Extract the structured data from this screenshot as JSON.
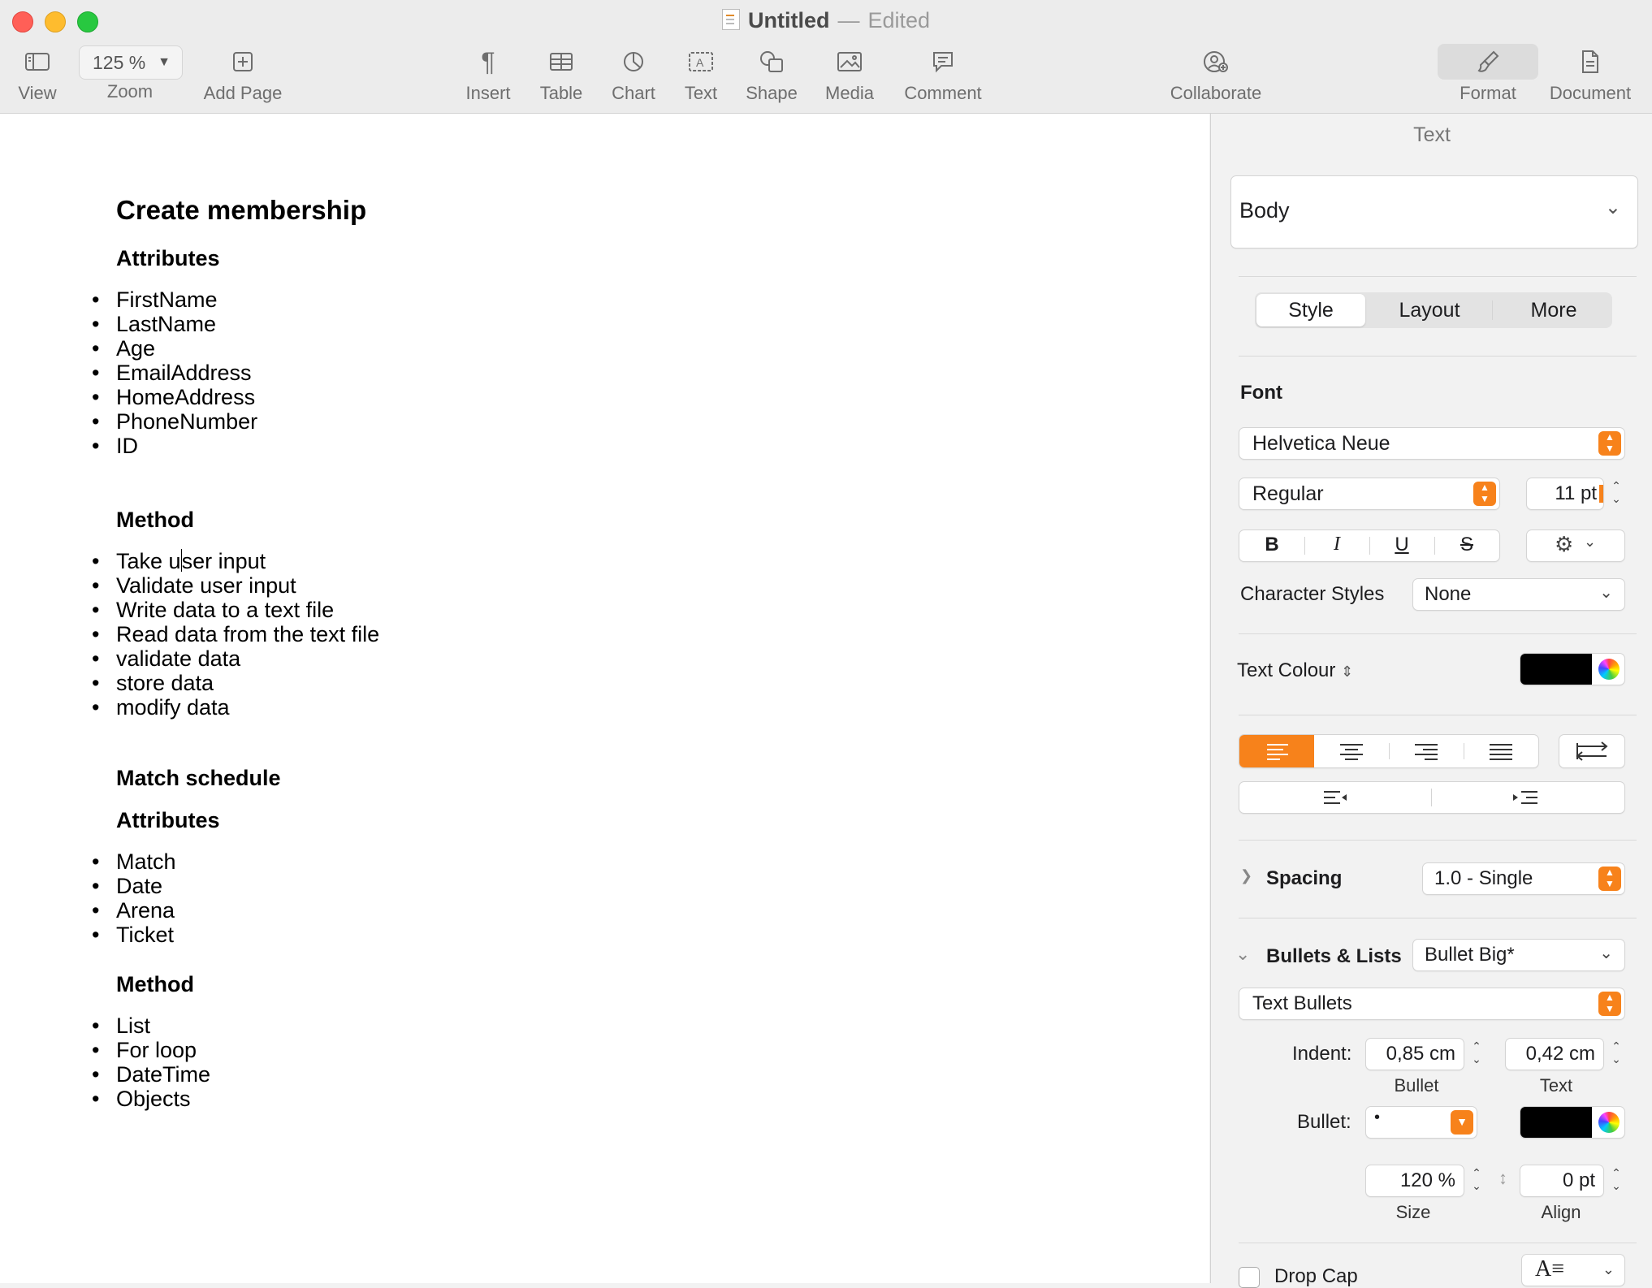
{
  "window": {
    "title": "Untitled",
    "separator": "—",
    "state": "Edited"
  },
  "toolbar": {
    "view": "View",
    "zoom_value": "125 %",
    "zoom": "Zoom",
    "add_page": "Add Page",
    "insert": "Insert",
    "table": "Table",
    "chart": "Chart",
    "text": "Text",
    "shape": "Shape",
    "media": "Media",
    "comment": "Comment",
    "collaborate": "Collaborate",
    "format": "Format",
    "document": "Document"
  },
  "doc": {
    "title": "Create membership",
    "attributes1_heading": "Attributes",
    "attributes1": [
      "FirstName",
      "LastName",
      "Age",
      "EmailAddress",
      "HomeAddress",
      "PhoneNumber",
      "ID"
    ],
    "method1_heading": "Method",
    "method1_first_a": "Take u",
    "method1_first_b": "ser input",
    "method1": [
      "Validate user input",
      "Write data to a text file",
      "Read data from the text file",
      "validate data",
      "store data",
      "modify data"
    ],
    "section2_title": "Match schedule",
    "attributes2_heading": "Attributes",
    "attributes2": [
      "Match",
      "Date",
      "Arena",
      "Ticket"
    ],
    "method2_heading": "Method",
    "method2": [
      "List",
      "For loop",
      "DateTime",
      "Objects"
    ]
  },
  "inspector": {
    "panel_title": "Text",
    "paragraph_style": "Body",
    "tabs": [
      "Style",
      "Layout",
      "More"
    ],
    "font_label": "Font",
    "font_family": "Helvetica Neue",
    "font_typeface": "Regular",
    "font_size": "11 pt",
    "bold": "B",
    "italic": "I",
    "underline": "U",
    "strike": "S",
    "char_styles_label": "Character Styles",
    "char_styles_value": "None",
    "text_colour_label": "Text Colour",
    "text_colour": "#000000",
    "accent_color": "#f7821b",
    "spacing_label": "Spacing",
    "spacing_value": "1.0 - Single",
    "bullets_label": "Bullets & Lists",
    "bullets_value": "Bullet Big*",
    "bullet_type": "Text Bullets",
    "indent_label": "Indent:",
    "indent_bullet": "0,85 cm",
    "indent_text": "0,42 cm",
    "indent_bullet_caption": "Bullet",
    "indent_text_caption": "Text",
    "bullet_label": "Bullet:",
    "bullet_char": "•",
    "size_value": "120 %",
    "align_value": "0 pt",
    "size_caption": "Size",
    "align_caption": "Align",
    "drop_cap": "Drop Cap"
  }
}
